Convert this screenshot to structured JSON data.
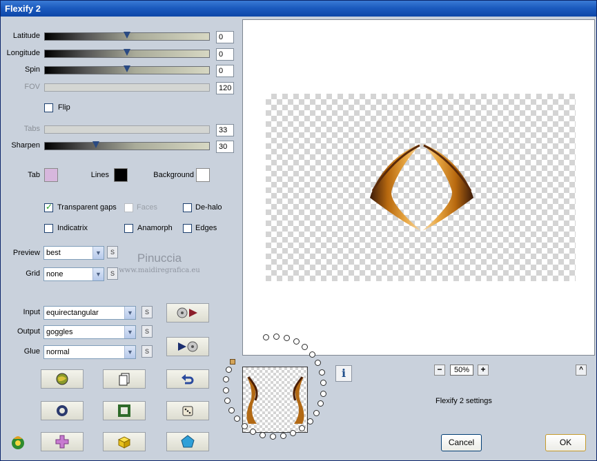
{
  "window": {
    "title": "Flexify 2"
  },
  "sliders": [
    {
      "label": "Latitude",
      "value": "0",
      "enabled": true
    },
    {
      "label": "Longitude",
      "value": "0",
      "enabled": true
    },
    {
      "label": "Spin",
      "value": "0",
      "enabled": true
    },
    {
      "label": "FOV",
      "value": "120",
      "enabled": false
    },
    {
      "label": "Tabs",
      "value": "33",
      "enabled": false
    },
    {
      "label": "Sharpen",
      "value": "30",
      "enabled": true
    }
  ],
  "flip": {
    "label": "Flip",
    "checked": false
  },
  "colors": {
    "tab": {
      "label": "Tab",
      "color": "#d7b7dd"
    },
    "lines": {
      "label": "Lines",
      "color": "#000000"
    },
    "background": {
      "label": "Background",
      "color": "#ffffff"
    }
  },
  "options": {
    "transparent_gaps": {
      "label": "Transparent gaps",
      "checked": true
    },
    "faces": {
      "label": "Faces",
      "checked": false,
      "enabled": false
    },
    "de_halo": {
      "label": "De-halo",
      "checked": false
    },
    "indicatrix": {
      "label": "Indicatrix",
      "checked": false
    },
    "anamorph": {
      "label": "Anamorph",
      "checked": false
    },
    "edges": {
      "label": "Edges",
      "checked": false
    }
  },
  "preview_select": {
    "label": "Preview",
    "value": "best"
  },
  "grid_select": {
    "label": "Grid",
    "value": "none"
  },
  "input_select": {
    "label": "Input",
    "value": "equirectangular"
  },
  "output_select": {
    "label": "Output",
    "value": "goggles"
  },
  "glue_select": {
    "label": "Glue",
    "value": "normal"
  },
  "watermark": {
    "name": "Pinuccia",
    "site": "www.maidiregrafica.eu"
  },
  "s_button_label": "S",
  "zoom": {
    "value": "50%",
    "minus": "−",
    "plus": "+"
  },
  "settings_label": "Flexify 2 settings",
  "buttons": {
    "cancel": "Cancel",
    "ok": "OK",
    "info": "i",
    "collapse": "^"
  },
  "accent": "#0a246a"
}
